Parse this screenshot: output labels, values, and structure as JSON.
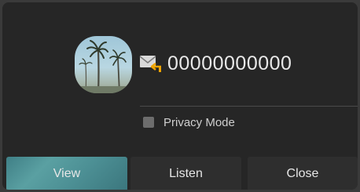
{
  "contact": {
    "number": "00000000000",
    "avatar_icon": "palm-tree-photo",
    "message_icon": "envelope-reply-icon"
  },
  "privacy": {
    "label": "Privacy Mode",
    "checked": false
  },
  "buttons": {
    "view": "View",
    "listen": "Listen",
    "close": "Close"
  },
  "colors": {
    "background": "#262626",
    "accent": "#4c8f94",
    "arrow": "#f0a400"
  }
}
